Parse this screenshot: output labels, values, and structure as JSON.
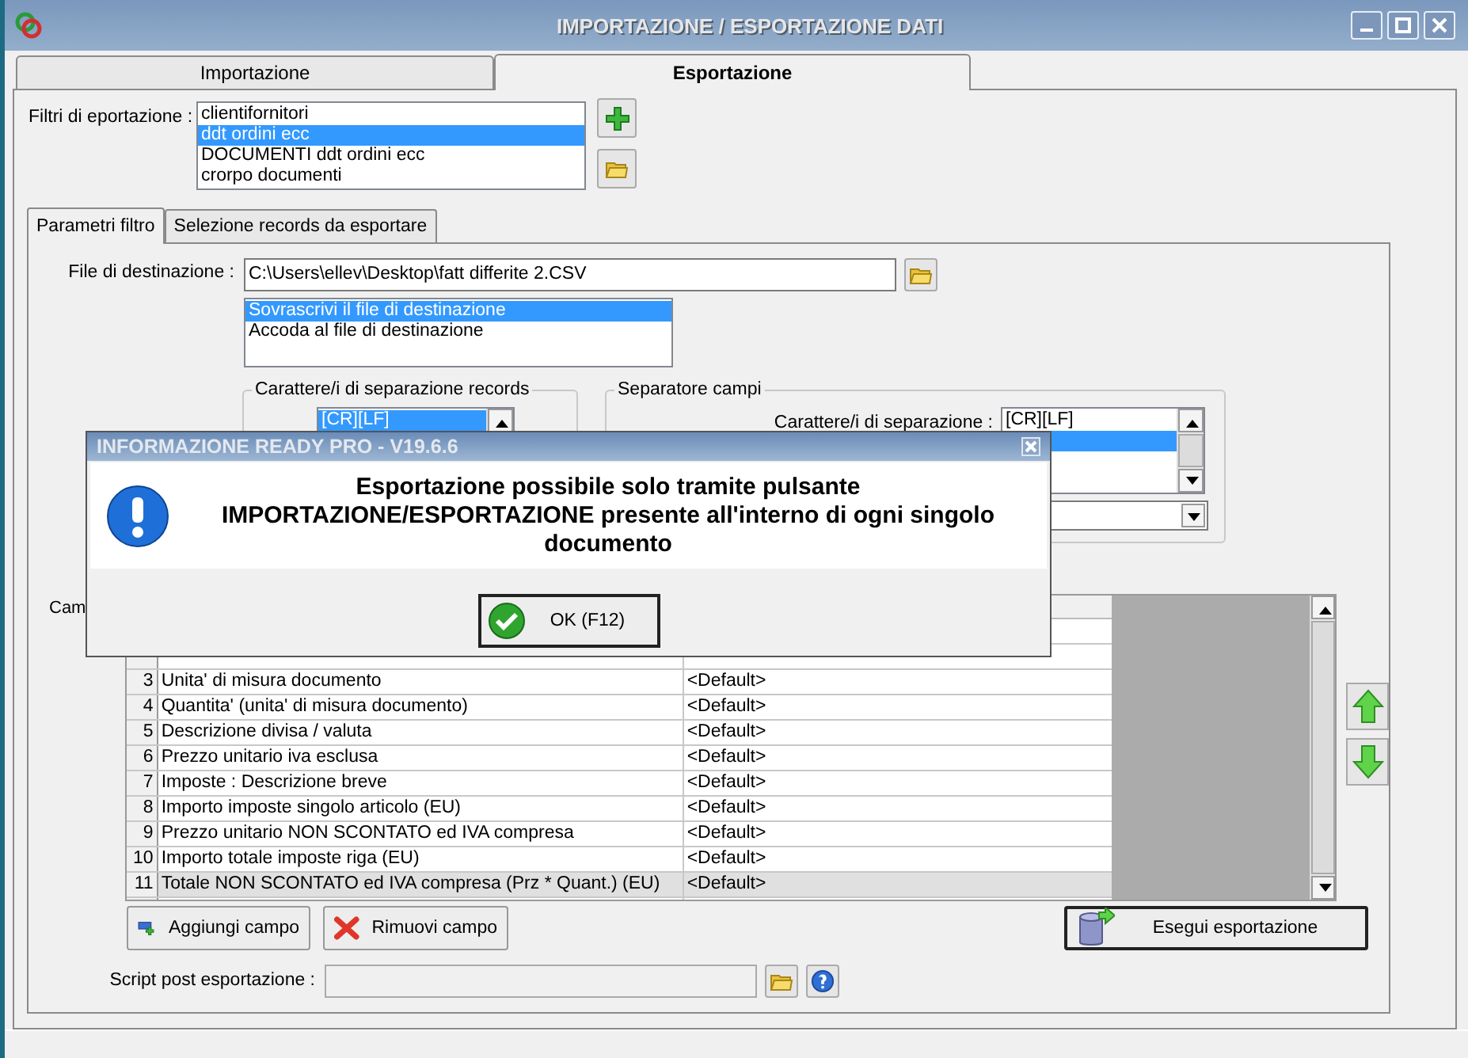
{
  "window": {
    "title": "IMPORTAZIONE / ESPORTAZIONE DATI"
  },
  "tabs": [
    {
      "label": "Importazione",
      "selected": false
    },
    {
      "label": "Esportazione",
      "selected": true
    }
  ],
  "export_filters": {
    "label": "Filtri di eportazione :",
    "items": [
      {
        "text": "clientifornitori",
        "selected": false
      },
      {
        "text": "ddt ordini ecc",
        "selected": true
      },
      {
        "text": "DOCUMENTI ddt ordini ecc",
        "selected": false
      },
      {
        "text": "crorpo documenti",
        "selected": false
      }
    ]
  },
  "sub_tabs": [
    {
      "label": "Parametri filtro",
      "selected": true
    },
    {
      "label": "Selezione records da esportare",
      "selected": false
    }
  ],
  "destination": {
    "label": "File di destinazione :",
    "value": "C:\\Users\\ellev\\Desktop\\fatt differite 2.CSV",
    "modes": [
      {
        "text": "Sovrascrivi il file di destinazione",
        "selected": true
      },
      {
        "text": "Accoda al file di destinazione",
        "selected": false
      }
    ]
  },
  "record_separator": {
    "title": "Carattere/i di separazione records",
    "items": [
      {
        "text": "[CR][LF]",
        "selected": true
      }
    ]
  },
  "field_separator": {
    "title": "Separatore campi",
    "label": "Carattere/i di separazione :",
    "items": [
      {
        "text": "[CR][LF]",
        "selected": false
      },
      {
        "selected": true
      }
    ]
  },
  "fields": {
    "label": "Cam",
    "rows": [
      {
        "number": "3",
        "field": "Unita' di misura documento",
        "value": "<Default>",
        "selected": false
      },
      {
        "number": "4",
        "field": "Quantita' (unita' di misura documento)",
        "value": "<Default>",
        "selected": false
      },
      {
        "number": "5",
        "field": "Descrizione divisa / valuta",
        "value": "<Default>",
        "selected": false
      },
      {
        "number": "6",
        "field": "Prezzo unitario iva esclusa",
        "value": "<Default>",
        "selected": false
      },
      {
        "number": "7",
        "field": "Imposte : Descrizione breve",
        "value": "<Default>",
        "selected": false
      },
      {
        "number": "8",
        "field": "Importo imposte singolo articolo (EU)",
        "value": "<Default>",
        "selected": false
      },
      {
        "number": "9",
        "field": "Prezzo unitario NON SCONTATO ed IVA compresa",
        "value": "<Default>",
        "selected": false
      },
      {
        "number": "10",
        "field": "Importo totale imposte riga (EU)",
        "value": "<Default>",
        "selected": false
      },
      {
        "number": "11",
        "field": "Totale NON SCONTATO ed IVA compresa (Prz * Quant.) (EU)",
        "value": "<Default>",
        "selected": true
      }
    ]
  },
  "field_buttons": [
    {
      "kind": "add",
      "label": "Aggiungi campo"
    },
    {
      "kind": "remove",
      "label": "Rimuovi campo"
    }
  ],
  "execute_button": {
    "label": "Esegui esportazione"
  },
  "post_script": {
    "label": "Script post esportazione :",
    "disabled": true
  },
  "dialog": {
    "title": "INFORMAZIONE READY PRO - V19.6.6",
    "message": "Esportazione possibile solo tramite pulsante IMPORTAZIONE/ESPORTAZIONE presente all'interno di ogni singolo documento",
    "button": "OK (F12)"
  }
}
